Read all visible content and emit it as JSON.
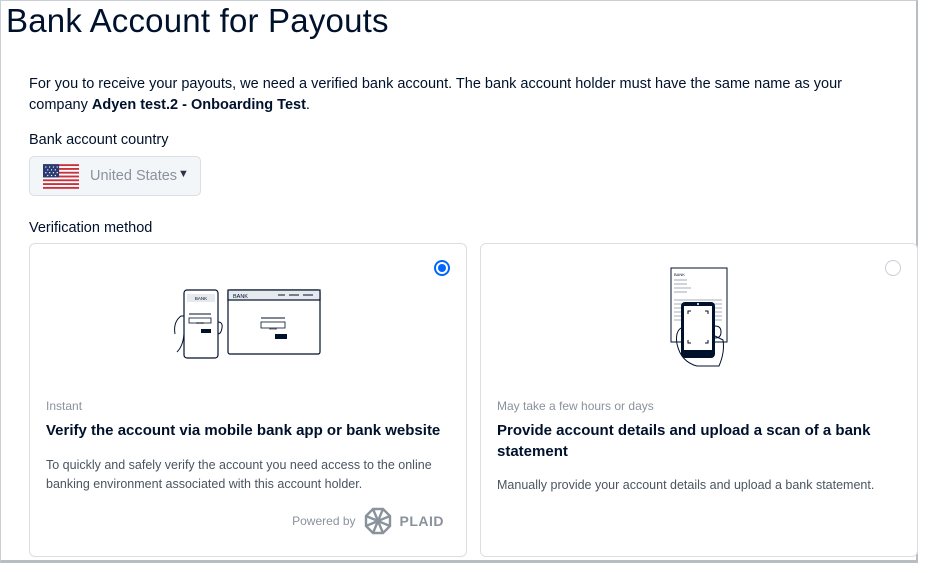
{
  "page": {
    "title": "Bank Account for Payouts",
    "intro_text": "For you to receive your payouts, we need a verified bank account. The bank account holder must have the same name as your company ",
    "company_name": "Adyen test.2 - Onboarding Test",
    "intro_end": "."
  },
  "country": {
    "label": "Bank account country",
    "selected": "United States",
    "flag_icon": "us-flag-icon"
  },
  "verification": {
    "label": "Verification method",
    "options": [
      {
        "eyebrow": "Instant",
        "title": "Verify the account via mobile bank app or bank website",
        "description": "To quickly and safely verify the account you need access to the online banking environment associated with this account holder.",
        "selected": true,
        "powered_by": "Powered by",
        "provider": "PLAID",
        "illustration": {
          "phone_text": "BANK",
          "browser_text": "BANK",
          "pin_phone": "****",
          "pin_browser": "****"
        }
      },
      {
        "eyebrow": "May take a few hours or days",
        "title": "Provide account details and upload a scan of a bank statement",
        "description": "Manually provide your account details and upload a bank statement.",
        "selected": false,
        "illustration": {
          "doc_text": "BANK"
        }
      }
    ]
  },
  "colors": {
    "accent": "#0066ff",
    "text": "#00112c",
    "muted": "#8a929c",
    "border": "#dbdee2"
  }
}
